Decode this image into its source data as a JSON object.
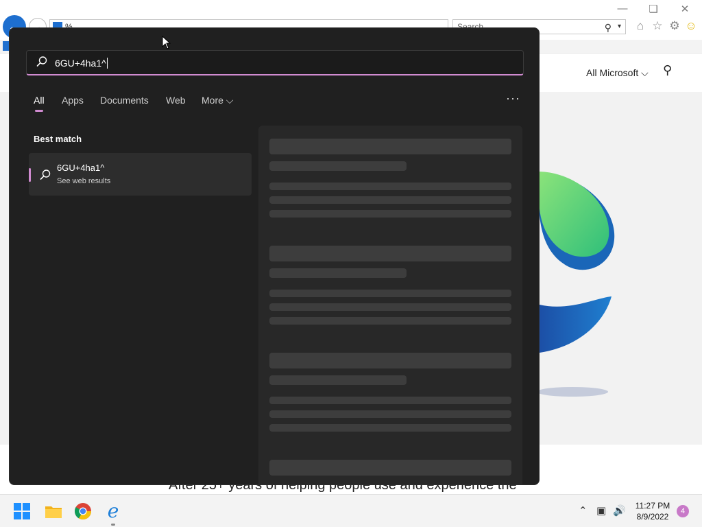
{
  "browser": {
    "address_text": "%",
    "search_placeholder": "Search",
    "header": {
      "all_microsoft": "All Microsoft ⌵"
    },
    "body_text": "After 25+ years of helping people use and experience the"
  },
  "search_panel": {
    "query": "6GU+4ha1^",
    "tabs": [
      {
        "label": "All",
        "active": true
      },
      {
        "label": "Apps"
      },
      {
        "label": "Documents"
      },
      {
        "label": "Web"
      },
      {
        "label": "More ⌵"
      }
    ],
    "more_options": "···",
    "best_match_title": "Best match",
    "best_match": {
      "title": "6GU+4ha1^",
      "subtitle": "See web results"
    }
  },
  "taskbar": {
    "apps": [
      "windows-start",
      "file-explorer",
      "chrome",
      "internet-explorer"
    ],
    "time": "11:27 PM",
    "date": "8/9/2022",
    "notification_count": "4"
  },
  "colors": {
    "accent": "#d08bd0",
    "panel_bg": "#202020",
    "ie_blue": "#1e6fcf"
  }
}
